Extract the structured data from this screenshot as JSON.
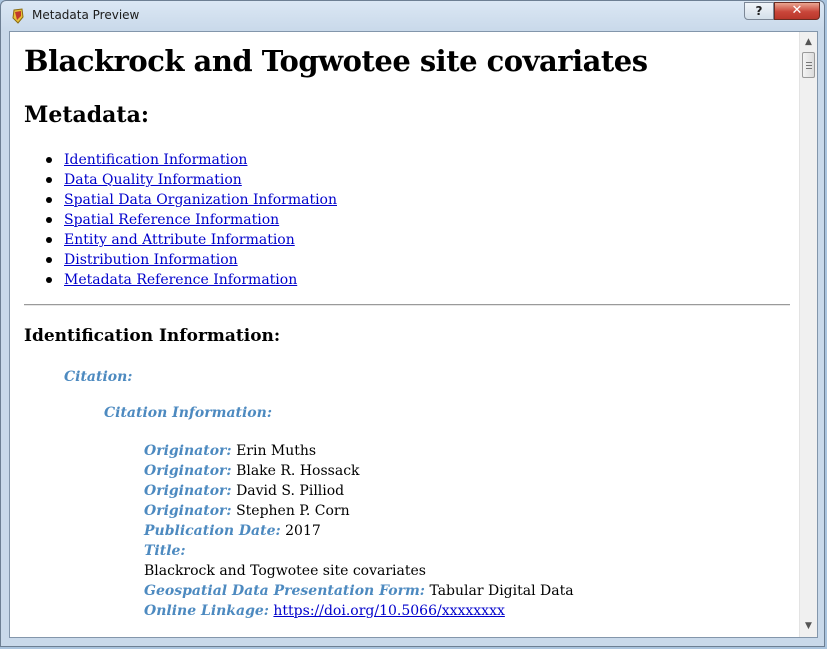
{
  "window": {
    "title": "Metadata Preview",
    "help_label": "?",
    "close_label": "✕"
  },
  "document": {
    "title": "Blackrock and Togwotee site covariates",
    "metadata_heading": "Metadata:",
    "toc": [
      "Identification Information",
      "Data Quality Information",
      "Spatial Data Organization Information",
      "Spatial Reference Information",
      "Entity and Attribute Information",
      "Distribution Information",
      "Metadata Reference Information"
    ],
    "section_heading": "Identification Information:",
    "citation_label": "Citation:",
    "citation_info_label": "Citation Information:",
    "fields": {
      "originator_label": "Originator:",
      "originators": [
        "Erin Muths",
        "Blake R. Hossack",
        "David S. Pilliod",
        "Stephen P. Corn"
      ],
      "pubdate_label": "Publication Date:",
      "pubdate": "2017",
      "title_label": "Title:",
      "title_value": "Blackrock and Togwotee site covariates",
      "geoform_label": "Geospatial Data Presentation Form:",
      "geoform": "Tabular Digital Data",
      "onlink_label": "Online Linkage:",
      "onlink": "https://doi.org/10.5066/xxxxxxxx"
    }
  },
  "scrollbar": {
    "up_icon": "▲",
    "down_icon": "▼",
    "position_fraction": 0.0
  },
  "colors": {
    "label": "#4d8ac0",
    "link": "#0000cc",
    "close_button": "#c9463a"
  }
}
